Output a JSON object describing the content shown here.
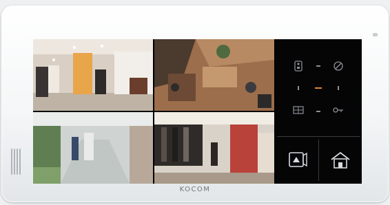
{
  "device": {
    "brand": "KOCOM"
  },
  "icons": {
    "top_left": "door-phone-icon",
    "top_center": "dot-icon",
    "top_right": "settings-dial-icon",
    "mid_left": "arrow-icon",
    "mid_center": "center-light-icon",
    "mid_right": "arrow-icon",
    "bottom_left": "menu-grid-icon",
    "bottom_center": "dot-icon",
    "bottom_right": "key-icon",
    "cctv": "cctv-monitor-icon",
    "home": "home-icon"
  },
  "colors": {
    "accent": "#d98a3a",
    "panel": "#050506",
    "icon": "#8c9096"
  }
}
